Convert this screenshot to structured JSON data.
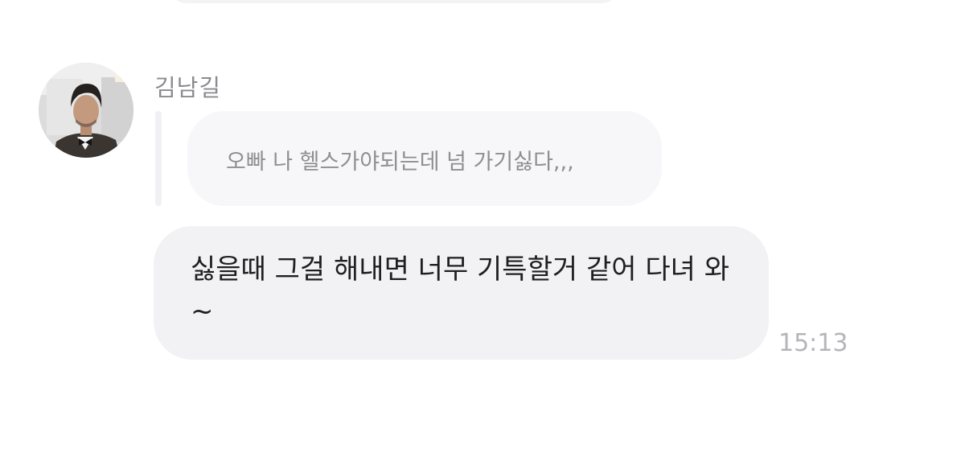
{
  "chat": {
    "sender_name": "김남길",
    "reply": {
      "quoted_text": "오빠 나 헬스가야되는데 넘 가기싫다,,,"
    },
    "message": {
      "text": "싫을때 그걸 해내면 너무 기특할거 같어 다녀 와~",
      "time": "15:13"
    }
  },
  "colors": {
    "quoted_bubble": "#f7f7fa",
    "message_bubble": "#f2f2f5",
    "name_text": "#8b8b90",
    "quoted_text": "#8e8e93",
    "message_text": "#1f1f22",
    "timestamp": "#b5b5ba"
  },
  "icons": {
    "avatar": "profile-photo"
  }
}
